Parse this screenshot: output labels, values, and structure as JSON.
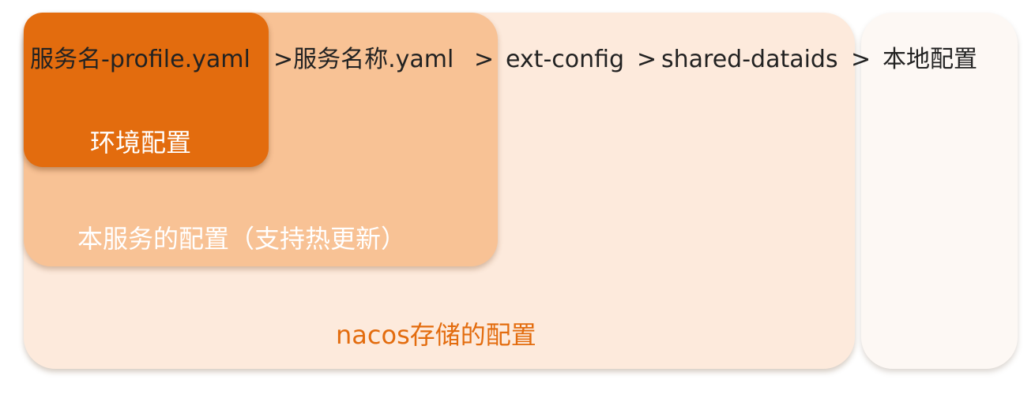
{
  "diagram": {
    "sequence": [
      "服务名-profile.yaml",
      ">服务名称.yaml",
      ">",
      "ext-config",
      ">",
      "shared-dataids",
      ">",
      "本地配置"
    ],
    "labels": {
      "environment_config": "环境配置",
      "service_config": "本服务的配置（支持热更新）",
      "nacos_config": "nacos存储的配置"
    },
    "colors": {
      "environment_box": "#e36c0e",
      "service_box": "#f8c295",
      "nacos_box": "#fdeadc",
      "local_box": "#fdf8f4",
      "nacos_label_text": "#e36c0e",
      "inner_label_text": "#ffffff",
      "sequence_text": "#222222"
    }
  }
}
